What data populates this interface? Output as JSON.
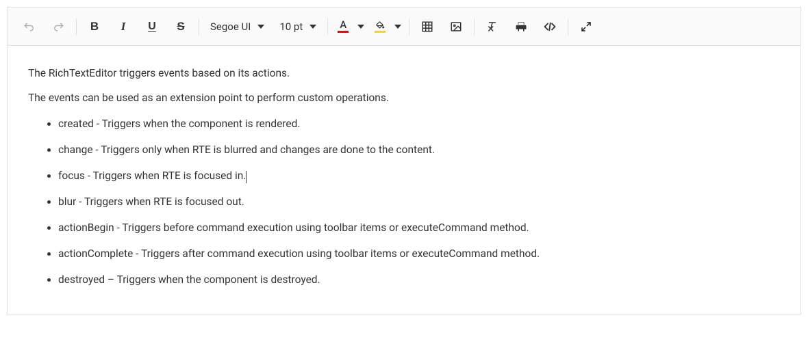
{
  "toolbar": {
    "font_name": "Segoe UI",
    "font_size": "10 pt"
  },
  "content": {
    "p1": "The RichTextEditor triggers events based on its actions.",
    "p2": "The events can be used as an extension point to perform custom operations.",
    "items": [
      "created - Triggers when the component is rendered.",
      "change - Triggers only when RTE is blurred and changes are done to the content.",
      "focus - Triggers when RTE is focused in.",
      "blur - Triggers when RTE is focused out.",
      "actionBegin - Triggers before command execution using toolbar items or executeCommand method.",
      "actionComplete - Triggers after command execution using toolbar items or executeCommand method.",
      "destroyed – Triggers when the component is destroyed."
    ]
  }
}
